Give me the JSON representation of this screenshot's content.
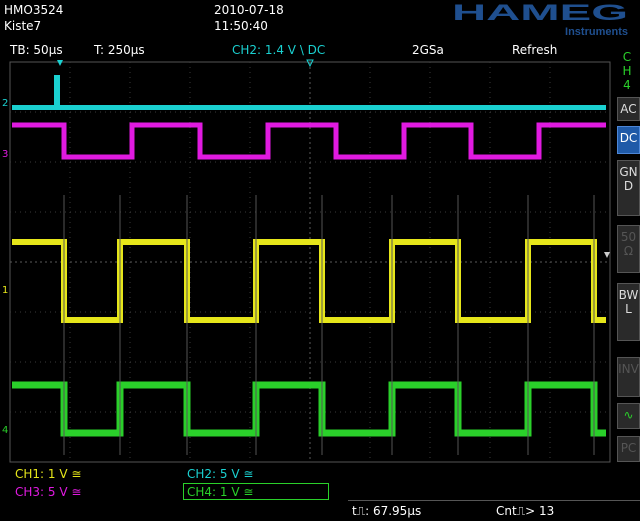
{
  "header": {
    "model": "HMO3524",
    "label": "Kiste7",
    "date": "2010-07-18",
    "time": "11:50:40",
    "brand": "HAMEG",
    "brand_sub": "Instruments"
  },
  "status": {
    "timebase": "TB: 50µs",
    "trigger_time": "T: 250µs",
    "trigger_info": "CH2: 1.4 V \\ DC",
    "sample_rate": "2GSa",
    "mode": "Refresh"
  },
  "side_panel": {
    "channel_label": "CH 4",
    "buttons": [
      {
        "label": "AC",
        "state": "normal"
      },
      {
        "label": "DC",
        "state": "active"
      },
      {
        "label": "GND",
        "state": "normal"
      },
      {
        "label": "50Ω",
        "state": "dim"
      },
      {
        "label": "BWL",
        "state": "normal"
      },
      {
        "label": "INV",
        "state": "dim"
      },
      {
        "label": "∿",
        "state": "green"
      },
      {
        "label": "PC",
        "state": "dim"
      }
    ]
  },
  "channels": [
    {
      "id": "CH1",
      "label": "CH1: 1 V ≅",
      "color": "#e6e61a"
    },
    {
      "id": "CH2",
      "label": "CH2: 5 V ≅",
      "color": "#1ad0d0"
    },
    {
      "id": "CH3",
      "label": "CH3: 5 V ≅",
      "color": "#e01ae0"
    },
    {
      "id": "CH4",
      "label": "CH4: 1 V ≅",
      "color": "#2ad02a"
    }
  ],
  "channel_markers": [
    "2",
    "3",
    "1",
    "4"
  ],
  "measurements": {
    "period": "t⎍: 67.95µs",
    "count": "Cnt⎍> 13"
  },
  "colors": {
    "grid": "#3a3a3a",
    "ch1": "#e6e61a",
    "ch2": "#1ad0d0",
    "ch3": "#e01ae0",
    "ch4": "#2ad02a",
    "brand": "#1f4f8f"
  }
}
